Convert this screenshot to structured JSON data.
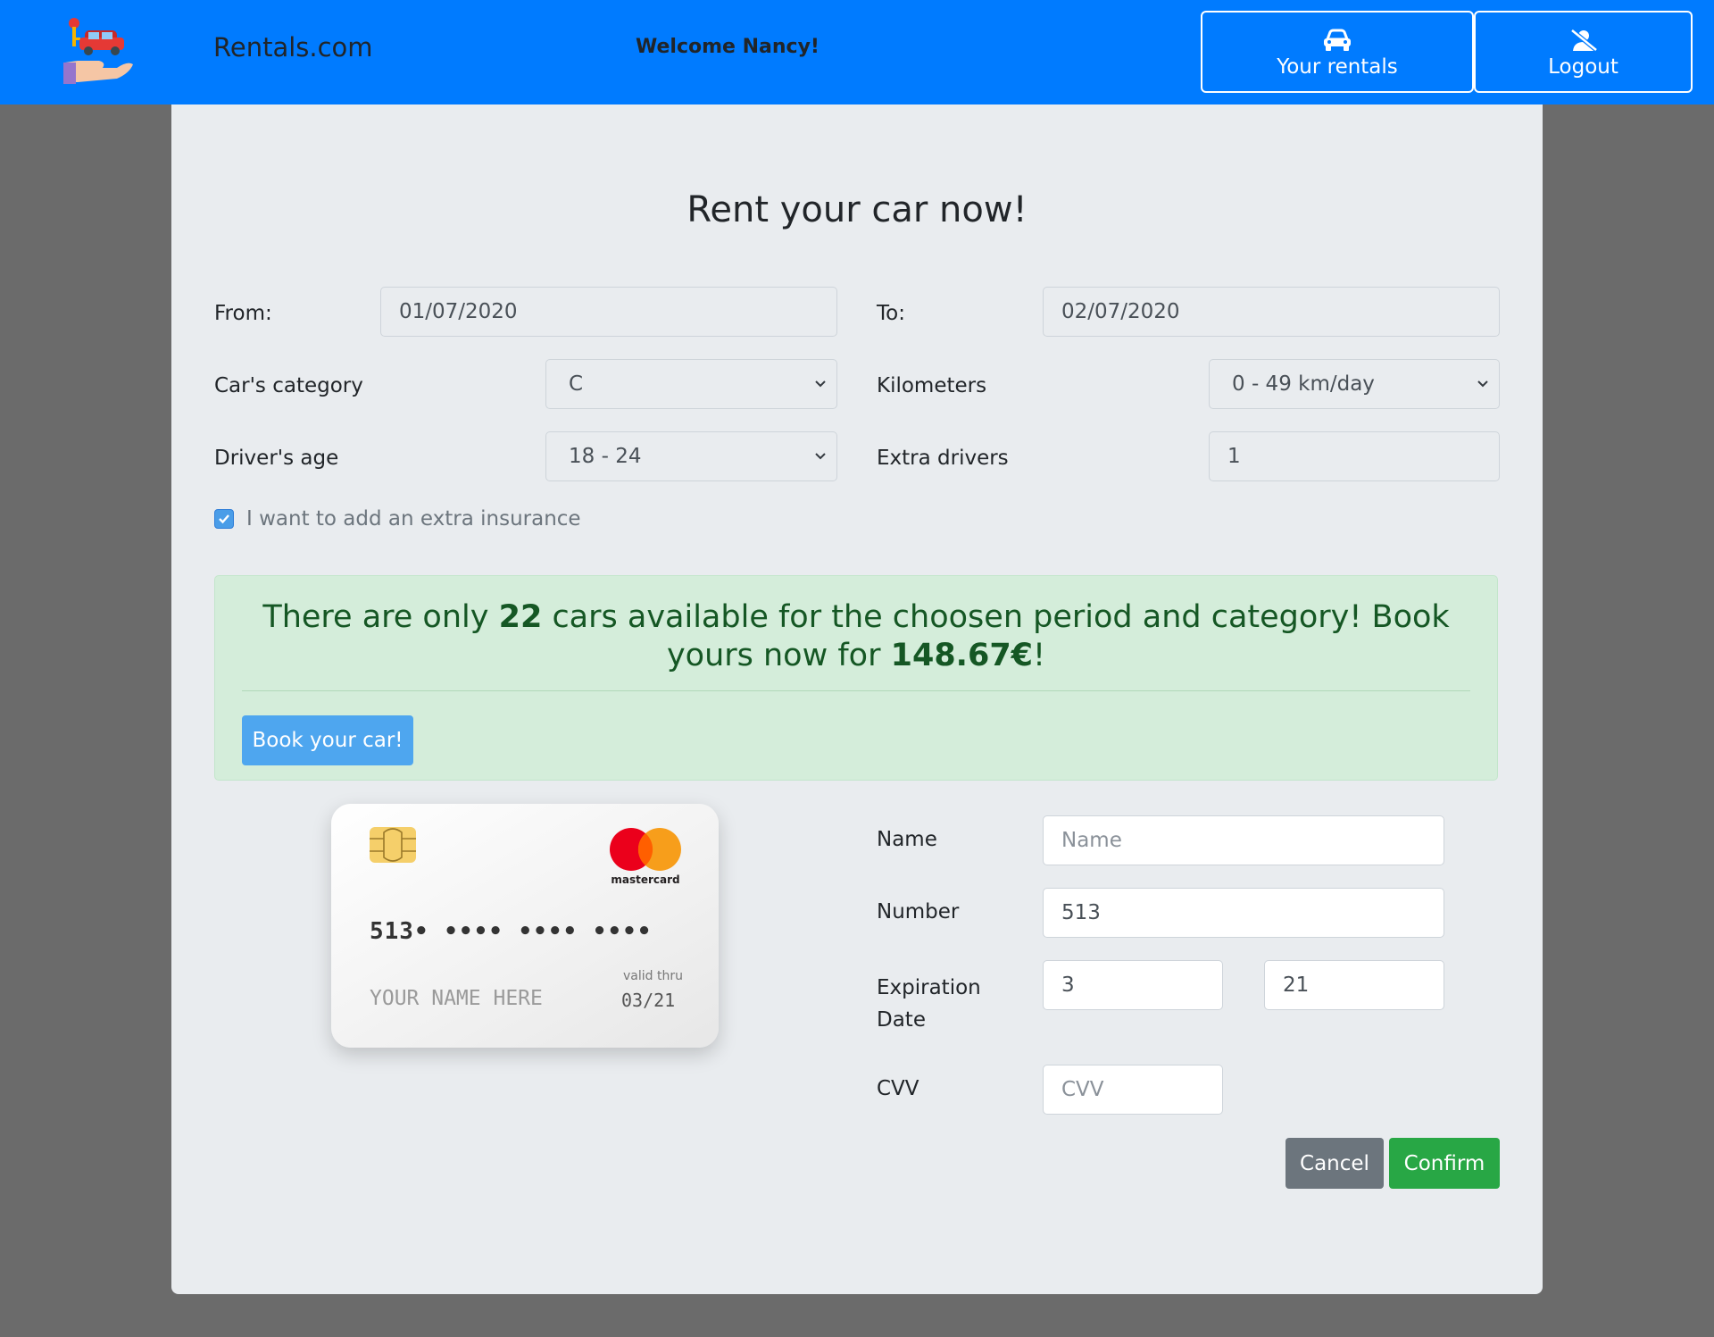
{
  "header": {
    "brand": "Rentals.com",
    "welcome": "Welcome Nancy!",
    "your_rentals_label": "Your rentals",
    "logout_label": "Logout",
    "background_color": "#007bff"
  },
  "form": {
    "title": "Rent your car now!",
    "from_label": "From:",
    "from_value": "01/07/2020",
    "to_label": "To:",
    "to_value": "02/07/2020",
    "category_label": "Car's category",
    "category_value": "C",
    "kilometers_label": "Kilometers",
    "kilometers_value": "0 - 49 km/day",
    "age_label": "Driver's age",
    "age_value": "18 - 24",
    "extra_drivers_label": "Extra drivers",
    "extra_drivers_value": "1",
    "insurance_label": "I want to add an extra insurance",
    "insurance_checked": true
  },
  "alert": {
    "text_1": "There are only ",
    "count": "22",
    "text_2": " cars available for the choosen period and category! Book yours now for ",
    "price": "148.67€",
    "text_3": "!",
    "book_label": "Book your car!"
  },
  "card": {
    "number": "513• •••• •••• ••••",
    "valid_label": "valid thru",
    "name": "YOUR NAME HERE",
    "expiry": "03/21",
    "brand": "mastercard"
  },
  "payment": {
    "name_label": "Name",
    "name_placeholder": "Name",
    "number_label": "Number",
    "number_value": "513",
    "expiration_label": "Expiration Date",
    "exp_month": "3",
    "exp_year": "21",
    "cvv_label": "CVV",
    "cvv_placeholder": "CVV",
    "cancel_label": "Cancel",
    "confirm_label": "Confirm"
  }
}
